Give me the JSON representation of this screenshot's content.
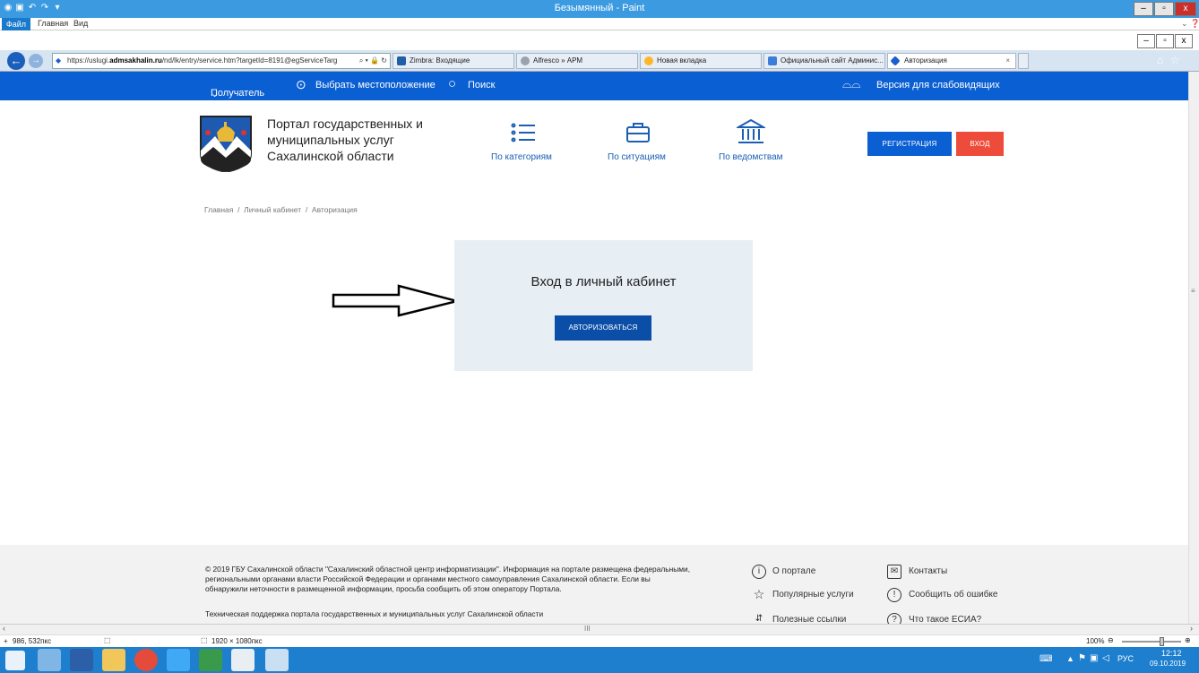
{
  "paint": {
    "title": "Безымянный - Paint",
    "tab_file": "Файл",
    "tab_home": "Главная",
    "tab_view": "Вид",
    "status_coords": "986, 532пкс",
    "status_size": "1920 × 1080пкс",
    "zoom": "100%",
    "minimize": "–",
    "maximize": "▫",
    "close": "x"
  },
  "browser": {
    "url_prefix": "https://uslugi.",
    "url_domain": "admsakhalin.ru",
    "url_suffix": "/nd/lk/entry/service.htm?targetId=8191@egServiceTarg",
    "url_tools": "⌕ ▾ 🔒 ↻",
    "tabs": [
      {
        "label": "Zimbra: Входящие",
        "color": "#1e5fa8"
      },
      {
        "label": "Alfresco » АРМ",
        "color": "#9aa3ad"
      },
      {
        "label": "Новая вкладка",
        "color": "#ffb627"
      },
      {
        "label": "Официальный сайт Админис...",
        "color": "#3c7dd9"
      },
      {
        "label": "Авторизация",
        "color": "#1a5fd0"
      }
    ],
    "tab_close": "×"
  },
  "site": {
    "recipient": "Получатель",
    "location": "Выбрать местоположение",
    "search": "Поиск",
    "low_vision": "Версия для слабовидящих",
    "logo_line1": "Портал государственных и",
    "logo_line2": "муниципальных услуг",
    "logo_line3": "Сахалинской области",
    "nav_categories": "По категориям",
    "nav_situations": "По ситуациям",
    "nav_departments": "По ведомствам",
    "register": "Регистрация",
    "login": "Вход",
    "breadcrumb": "Главная  /  Личный кабинет  /  Авторизация",
    "login_title": "Вход в личный кабинет",
    "authorize": "Авторизоваться",
    "footer_text_1": "© 2019 ГБУ Сахалинской области \"Сахалинский областной центр информатизации\". Информация на портале размещена федеральными,",
    "footer_text_2": "региональными органами власти Российской Федерации и органами местного самоуправления Сахалинской области. Если вы",
    "footer_text_3": "обнаружили неточности в размещенной информации, просьба сообщить об этом оператору Портала.",
    "footer_support": "Техническая поддержка портала государственных и муниципальных услуг Сахалинской области",
    "footer_about": "О портале",
    "footer_contacts": "Контакты",
    "footer_popular": "Популярные услуги",
    "footer_report": "Сообщить об ошибке",
    "footer_useful": "Полезные ссылки",
    "footer_esia": "Что такое ЕСИА?"
  },
  "taskbar": {
    "lang": "РУС",
    "time": "12:12",
    "date": "09.10.2019"
  }
}
